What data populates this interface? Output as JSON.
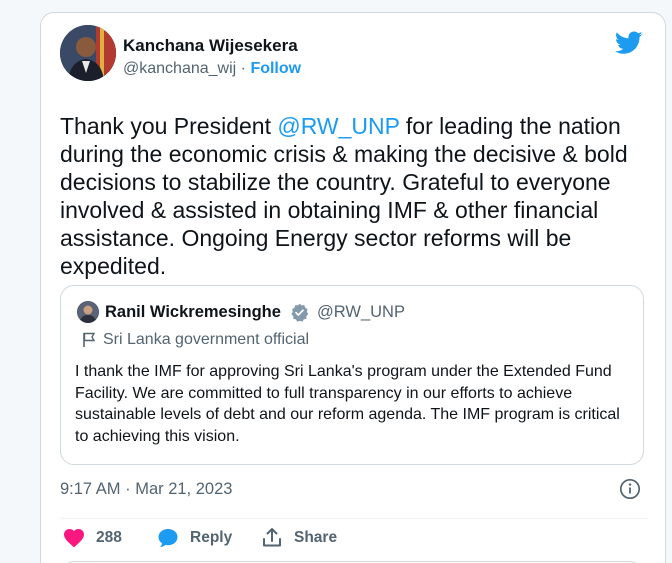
{
  "author": {
    "name": "Kanchana Wijesekera",
    "handle": "@kanchana_wij",
    "separator": "·",
    "follow_label": "Follow"
  },
  "tweet": {
    "text_before_mention": "Thank you President ",
    "mention": "@RW_UNP",
    "text_after_mention": " for leading the nation during the economic crisis & making the decisive & bold decisions to stabilize the country. Grateful to everyone involved & assisted in obtaining IMF & other financial assistance. Ongoing Energy sector reforms will be expedited."
  },
  "quoted_tweet": {
    "name": "Ranil Wickremesinghe",
    "handle": "@RW_UNP",
    "label": "Sri Lanka government official",
    "text": "I thank the IMF  for approving Sri Lanka's program under the Extended Fund Facility.  We are committed to full transparency in our efforts to achieve sustainable levels of debt and our reform agenda. The IMF program is critical to achieving this vision."
  },
  "timestamp": "9:17 AM · Mar 21, 2023",
  "actions": {
    "like_count": "288",
    "reply_label": "Reply",
    "share_label": "Share"
  },
  "colors": {
    "accent": "#1d9bf0",
    "like": "#f91880",
    "text_primary": "#0f1419",
    "text_secondary": "#536471",
    "border": "#cfd9de"
  },
  "icons": [
    "twitter-bird-icon",
    "verified-badge-icon",
    "government-flag-icon",
    "info-icon",
    "heart-icon",
    "reply-bubble-icon",
    "share-icon"
  ]
}
